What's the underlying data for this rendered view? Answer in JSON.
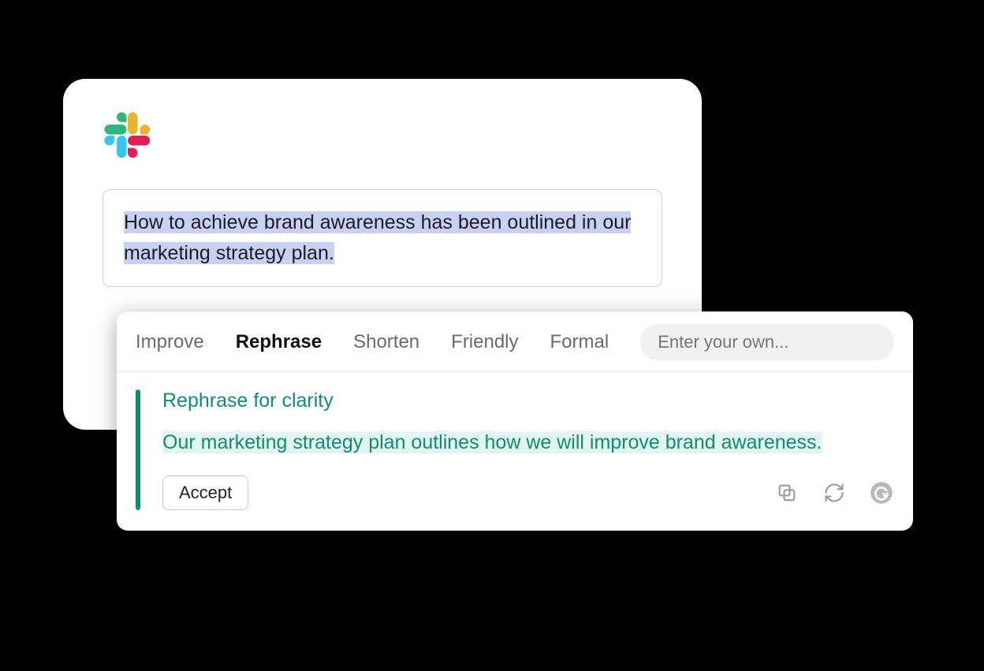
{
  "slack": {
    "message": "How to achieve brand awareness has been outlined in our marketing strategy plan."
  },
  "suggestion": {
    "tabs": {
      "improve": "Improve",
      "rephrase": "Rephrase",
      "shorten": "Shorten",
      "friendly": "Friendly",
      "formal": "Formal"
    },
    "custom_placeholder": "Enter your own...",
    "title": "Rephrase for clarity",
    "text": "Our marketing strategy plan outlines how we will improve brand awareness.",
    "accept_label": "Accept"
  }
}
